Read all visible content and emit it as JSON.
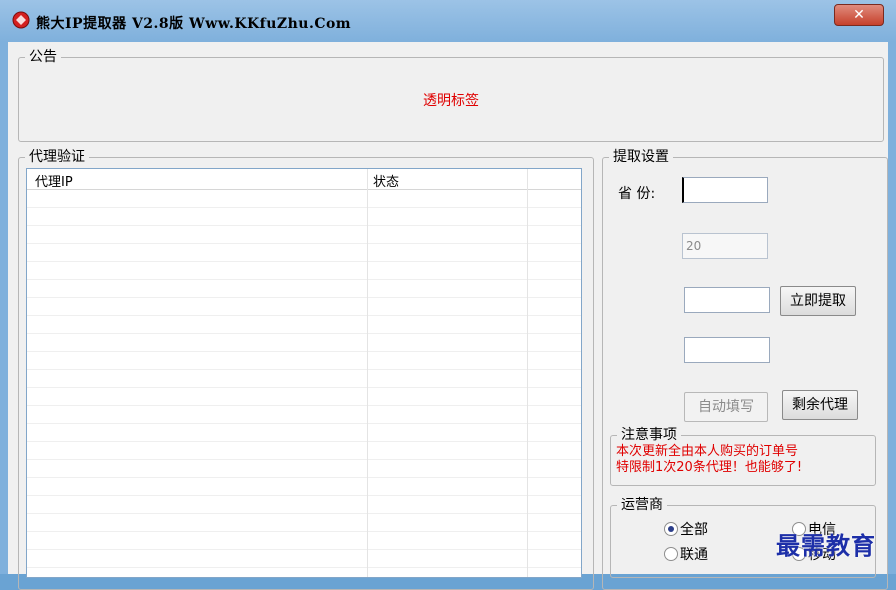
{
  "window": {
    "title": "熊大IP提取器  V2.8版  Www.KKfuZhu.Com",
    "close_label": "✕"
  },
  "notice": {
    "legend": "公告",
    "text": "透明标签"
  },
  "proxy_verify": {
    "legend": "代理验证",
    "columns": [
      "代理IP",
      "状态"
    ]
  },
  "extract_settings": {
    "legend": "提取设置",
    "province_label": "省  份:",
    "province_value": "",
    "count_value": "20",
    "field3_value": "",
    "field4_value": "",
    "extract_now_button": "立即提取",
    "auto_fill_button": "自动填写",
    "remaining_proxy_button": "剩余代理"
  },
  "attention": {
    "legend": "注意事项",
    "line1": "本次更新全由本人购买的订单号",
    "line2": "特限制1次20条代理！也能够了!"
  },
  "operator": {
    "legend": "运营商",
    "options": [
      "全部",
      "电信",
      "联通",
      "移动"
    ],
    "selected": "全部"
  },
  "watermark": "最需教育",
  "colors": {
    "accent_red": "#e00000",
    "title_bar": "#7fb0dc"
  }
}
